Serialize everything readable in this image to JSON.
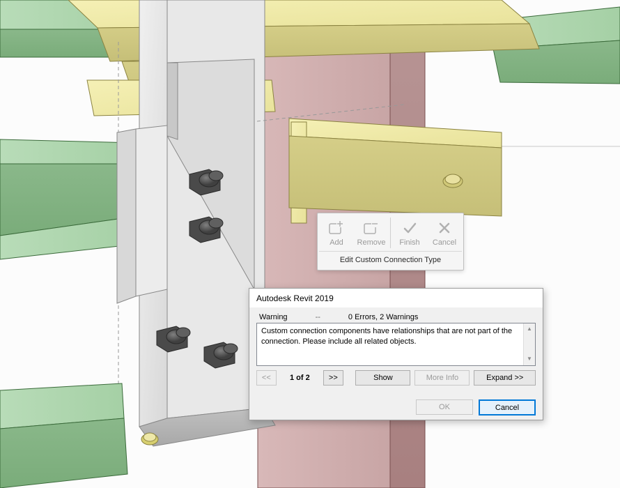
{
  "toolbar": {
    "add": "Add",
    "remove": "Remove",
    "finish": "Finish",
    "cancel": "Cancel",
    "footer": "Edit Custom Connection Type"
  },
  "dialog": {
    "title": "Autodesk Revit 2019",
    "status_type": "Warning",
    "status_dash": "--",
    "status_counts": "0 Errors, 2 Warnings",
    "message": "Custom connection components have relationships that are not part of the connection.  Please include all related objects.",
    "pager_prev": "<<",
    "pager_text": "1 of 2",
    "pager_next": ">>",
    "show": "Show",
    "more_info": "More Info",
    "expand": "Expand >>",
    "ok": "OK",
    "cancel": "Cancel"
  }
}
